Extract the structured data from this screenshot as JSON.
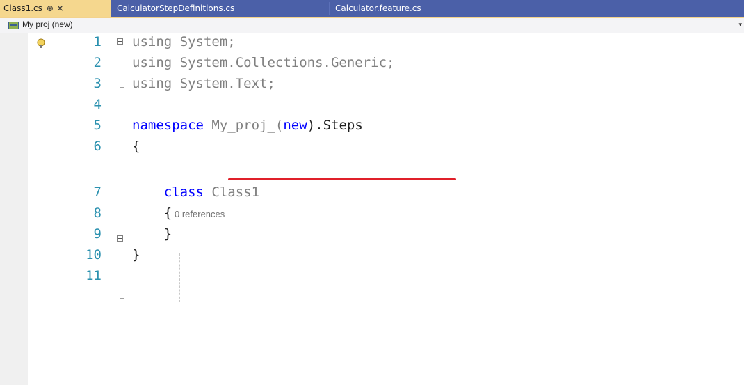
{
  "tabs": [
    {
      "label": "Class1.cs",
      "active": true,
      "pin": "⊕",
      "close": "×"
    },
    {
      "label": "CalculatorStepDefinitions.cs",
      "active": false
    },
    {
      "label": "Calculator.feature.cs",
      "active": false
    }
  ],
  "navbar": {
    "project": "My proj (new)",
    "dropdown": "▾"
  },
  "codelens": {
    "class1": "0 references"
  },
  "lines": [
    {
      "num": "1",
      "tokens": [
        {
          "t": "using",
          "c": "dimkw"
        },
        {
          "t": " System;",
          "c": "dim"
        }
      ]
    },
    {
      "num": "2",
      "tokens": [
        {
          "t": "using",
          "c": "dimkw"
        },
        {
          "t": " System.Collections.Generic;",
          "c": "dim"
        }
      ]
    },
    {
      "num": "3",
      "tokens": [
        {
          "t": "using",
          "c": "dimkw"
        },
        {
          "t": " System.Text;",
          "c": "dim"
        }
      ]
    },
    {
      "num": "4",
      "tokens": []
    },
    {
      "num": "5",
      "tokens": [
        {
          "t": "namespace",
          "c": "kw"
        },
        {
          "t": " ",
          "c": ""
        },
        {
          "t": "My_proj_(",
          "c": "dim"
        },
        {
          "t": "new",
          "c": "kw"
        },
        {
          "t": ").Steps",
          "c": ""
        }
      ]
    },
    {
      "num": "6",
      "tokens": [
        {
          "t": "{",
          "c": ""
        }
      ]
    },
    {
      "num": "7",
      "tokens": [
        {
          "t": "    class",
          "c": "kw"
        },
        {
          "t": " Class1",
          "c": "dim"
        }
      ]
    },
    {
      "num": "8",
      "tokens": [
        {
          "t": "    {",
          "c": ""
        }
      ]
    },
    {
      "num": "9",
      "tokens": [
        {
          "t": "    }",
          "c": ""
        }
      ]
    },
    {
      "num": "10",
      "tokens": [
        {
          "t": "}",
          "c": ""
        }
      ]
    },
    {
      "num": "11",
      "tokens": []
    }
  ],
  "colors": {
    "tabbar": "#4b60a8",
    "active_tab": "#f5d78e",
    "line_number": "#2b91af",
    "keyword": "#0000ff",
    "annotation": "#e0202a"
  }
}
